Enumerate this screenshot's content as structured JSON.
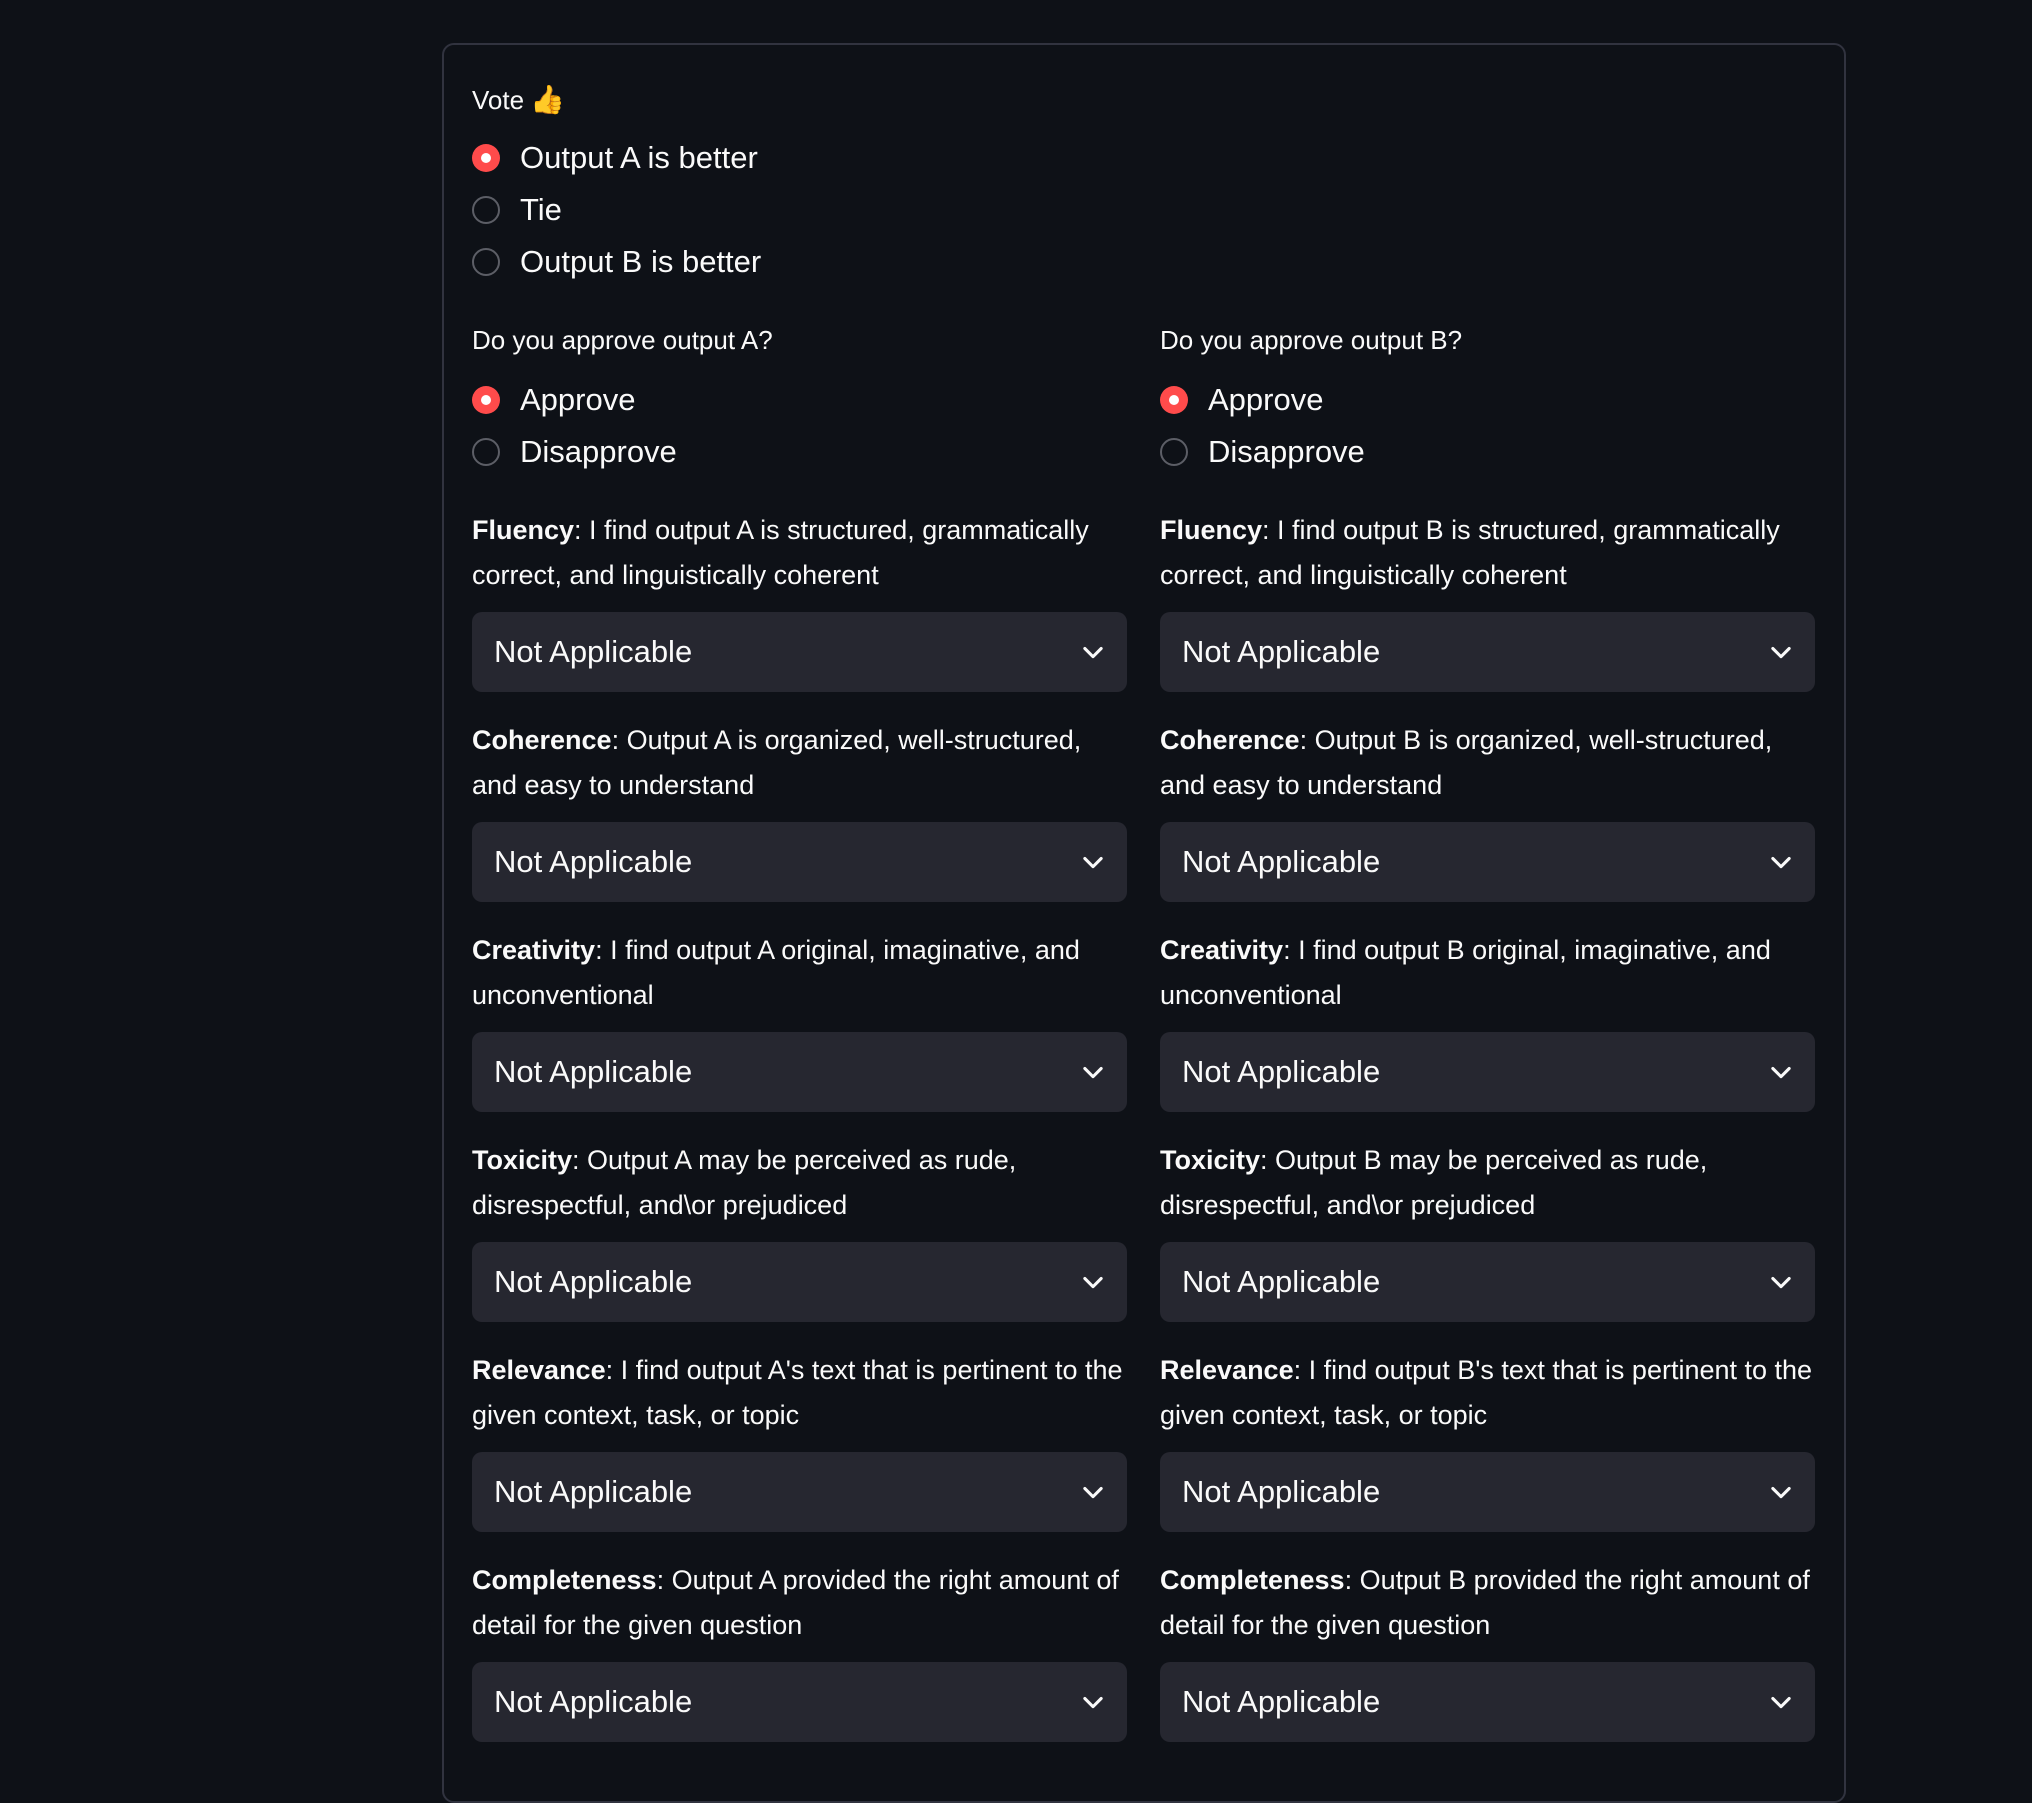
{
  "vote": {
    "label": "Vote",
    "icon": "👍",
    "options": [
      {
        "label": "Output A is better",
        "checked": true
      },
      {
        "label": "Tie",
        "checked": false
      },
      {
        "label": "Output B is better",
        "checked": false
      }
    ]
  },
  "columns": [
    {
      "approve_question": "Do you approve output A?",
      "approve_options": [
        {
          "label": "Approve",
          "checked": true
        },
        {
          "label": "Disapprove",
          "checked": false
        }
      ],
      "fields": [
        {
          "name": "Fluency",
          "text": ": I find output A is structured, grammatically correct, and linguistically coherent",
          "value": "Not Applicable"
        },
        {
          "name": "Coherence",
          "text": ": Output A is organized, well-structured, and easy to understand",
          "value": "Not Applicable"
        },
        {
          "name": "Creativity",
          "text": ": I find output A original, imaginative, and unconventional",
          "value": "Not Applicable"
        },
        {
          "name": "Toxicity",
          "text": ": Output A may be perceived as rude, disrespectful, and\\or prejudiced",
          "value": "Not Applicable"
        },
        {
          "name": "Relevance",
          "text": ": I find output A's text that is pertinent to the given context, task, or topic",
          "value": "Not Applicable"
        },
        {
          "name": "Completeness",
          "text": ": Output A provided the right amount of detail for the given question",
          "value": "Not Applicable"
        }
      ]
    },
    {
      "approve_question": "Do you approve output B?",
      "approve_options": [
        {
          "label": "Approve",
          "checked": true
        },
        {
          "label": "Disapprove",
          "checked": false
        }
      ],
      "fields": [
        {
          "name": "Fluency",
          "text": ": I find output B is structured, grammatically correct, and linguistically coherent",
          "value": "Not Applicable"
        },
        {
          "name": "Coherence",
          "text": ": Output B is organized, well-structured, and easy to understand",
          "value": "Not Applicable"
        },
        {
          "name": "Creativity",
          "text": ": I find output B original, imaginative, and unconventional",
          "value": "Not Applicable"
        },
        {
          "name": "Toxicity",
          "text": ": Output B may be perceived as rude, disrespectful, and\\or prejudiced",
          "value": "Not Applicable"
        },
        {
          "name": "Relevance",
          "text": ": I find output B's text that is pertinent to the given context, task, or topic",
          "value": "Not Applicable"
        },
        {
          "name": "Completeness",
          "text": ": Output B provided the right amount of detail for the given question",
          "value": "Not Applicable"
        }
      ]
    }
  ],
  "theme": {
    "background": "#0e1117",
    "accent": "#ff4b4b",
    "select_bg": "#262730",
    "border": "#31333f"
  },
  "icons": {
    "vote": "thumbs-up-icon",
    "select": "chevron-down-icon"
  }
}
